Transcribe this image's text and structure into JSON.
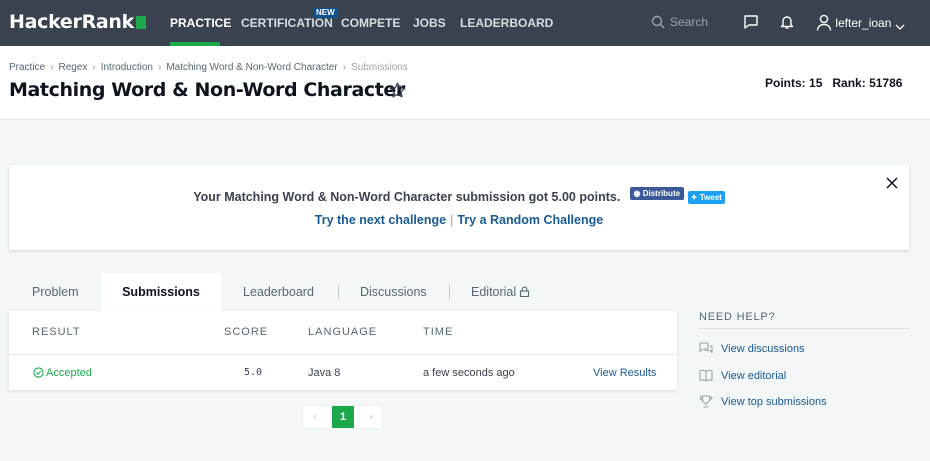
{
  "nav": {
    "logo": "HackerRank",
    "links": [
      "PRACTICE",
      "CERTIFICATION",
      "COMPETE",
      "JOBS",
      "LEADERBOARD"
    ],
    "new_badge": "NEW",
    "search_placeholder": "Search",
    "username": "lefter_ioan"
  },
  "breadcrumb": [
    "Practice",
    "Regex",
    "Introduction",
    "Matching Word & Non-Word Character",
    "Submissions"
  ],
  "title": "Matching Word & Non-Word Character",
  "stats": {
    "points_label": "Points:",
    "points": "15",
    "rank_label": "Rank:",
    "rank": "51786"
  },
  "success": {
    "message": "Your Matching Word & Non-Word Character submission got 5.00 points.",
    "fb_label": "Distribute",
    "tweet_label": "Tweet",
    "next_link": "Try the next challenge",
    "separator": "|",
    "random_link": "Try a Random Challenge"
  },
  "tabs": [
    "Problem",
    "Submissions",
    "Leaderboard",
    "Discussions",
    "Editorial"
  ],
  "table": {
    "headers": [
      "RESULT",
      "SCORE",
      "LANGUAGE",
      "TIME"
    ],
    "rows": [
      {
        "result": "Accepted",
        "score": "5.0",
        "language": "Java 8",
        "time": "a few seconds ago",
        "action": "View Results"
      }
    ]
  },
  "pagination": {
    "prev": "‹",
    "current": "1",
    "next": "›"
  },
  "help": {
    "title": "NEED HELP?",
    "items": [
      "View discussions",
      "View editorial",
      "View top submissions"
    ]
  },
  "colors": {
    "nav_bg": "#39424e",
    "accent_green": "#1ba94c",
    "link_blue": "#1a5a94"
  },
  "icons": [
    "search-icon",
    "chat-icon",
    "bell-icon",
    "user-icon",
    "chevron-down-icon",
    "star-icon",
    "close-icon",
    "lock-icon",
    "check-circle-icon",
    "discussions-icon",
    "book-icon",
    "trophy-icon"
  ]
}
